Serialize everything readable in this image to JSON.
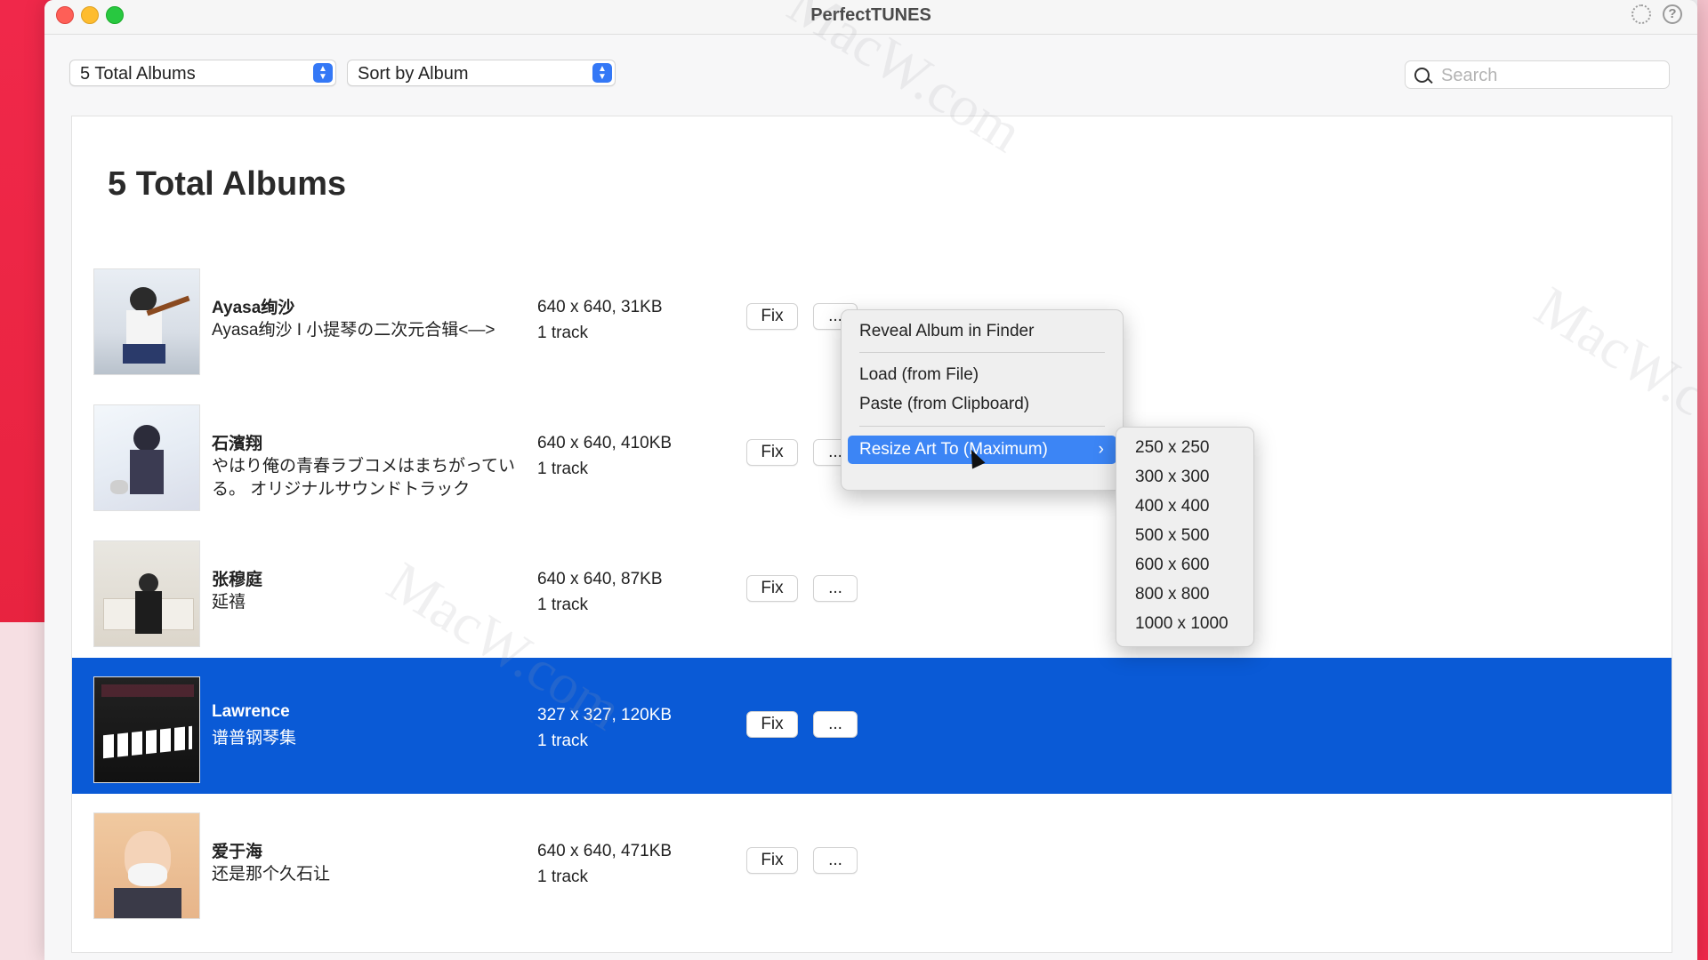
{
  "window": {
    "title": "PerfectTUNES"
  },
  "toolbar": {
    "filter_select": "5 Total Albums",
    "sort_select": "Sort by Album",
    "search_placeholder": "Search"
  },
  "main": {
    "heading": "5 Total Albums",
    "fix_label": "Fix",
    "more_label": "...",
    "albums": [
      {
        "artist": "Ayasa绚沙",
        "album": "Ayasa绚沙 I 小提琴の二次元合辑<—>",
        "art": "640 x 640, 31KB",
        "tracks": "1 track"
      },
      {
        "artist": "石濱翔",
        "album": "やはり俺の青春ラブコメはまちがっている。 オリジナルサウンドトラック",
        "art": "640 x 640, 410KB",
        "tracks": "1 track"
      },
      {
        "artist": "张穆庭",
        "album": "延禧",
        "art": "640 x 640, 87KB",
        "tracks": "1 track"
      },
      {
        "artist": "Lawrence",
        "album": "谱普钢琴集",
        "art": "327 x 327, 120KB",
        "tracks": "1 track",
        "selected": true
      },
      {
        "artist": "爱于海",
        "album": "还是那个久石让",
        "art": "640 x 640, 471KB",
        "tracks": "1 track"
      }
    ]
  },
  "context_menu": {
    "items": [
      "Reveal Album in Finder",
      "Load (from File)",
      "Paste (from Clipboard)",
      "Resize Art To (Maximum)"
    ],
    "highlighted": "Resize Art To (Maximum)",
    "submenu": [
      "250 x 250",
      "300 x 300",
      "400 x 400",
      "500 x 500",
      "600 x 600",
      "800 x 800",
      "1000 x 1000"
    ]
  },
  "watermark": "MacW.com",
  "colors": {
    "selection": "#0a5ad6",
    "menu_highlight": "#3c85f5",
    "accent": "#3478f6"
  }
}
